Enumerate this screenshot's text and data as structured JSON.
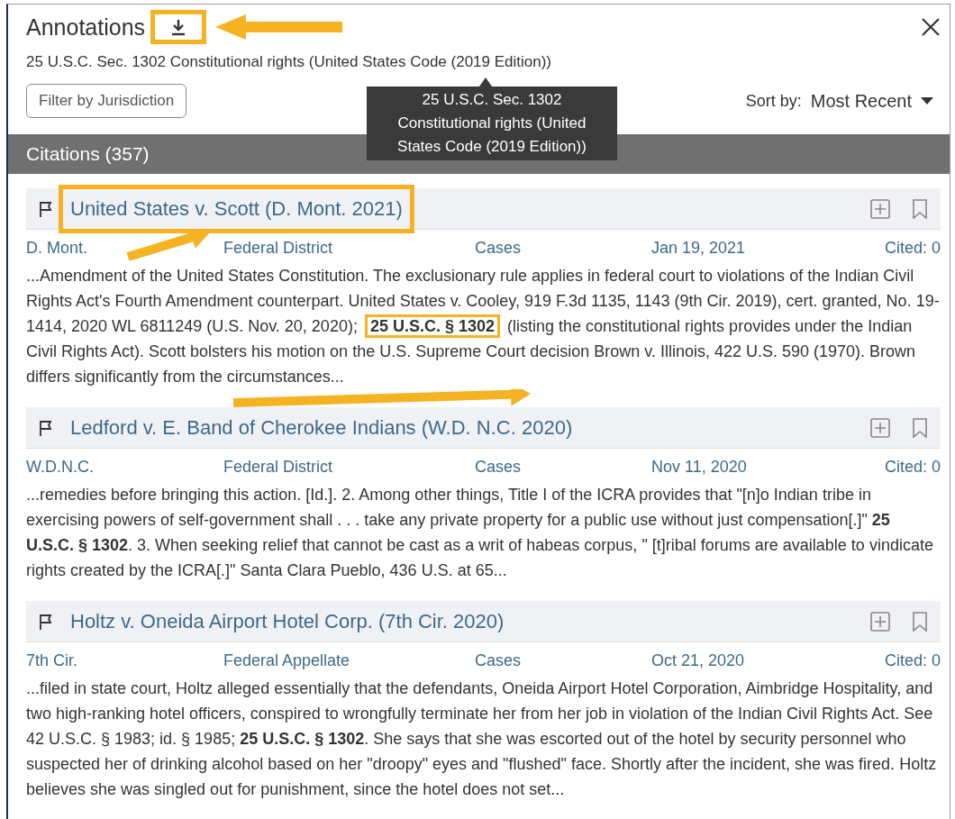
{
  "panel": {
    "title": "Annotations",
    "subtitle": "25 U.S.C. Sec. 1302 Constitutional rights (United States Code (2019 Edition))",
    "filter_button": "Filter by Jurisdiction",
    "sort": {
      "label": "Sort by:",
      "value": "Most Recent"
    },
    "tooltip": "25 U.S.C. Sec. 1302 Constitutional rights (United States Code (2019 Edition))",
    "download_highlighted": true
  },
  "citations": {
    "heading": "Citations (357)",
    "items": [
      {
        "title": "United States v. Scott (D. Mont. 2021)",
        "court": "D. Mont.",
        "level": "Federal District",
        "category": "Cases",
        "date": "Jan 19, 2021",
        "cited": "Cited: 0",
        "highlighted": true,
        "excerpt": "...Amendment of the United States Constitution. The exclusionary rule applies in federal court to violations of the Indian Civil Rights Act's Fourth Amendment counterpart. United States v. Cooley, 919 F.3d 1135, 1143 (9th Cir. 2019), cert. granted, No. 19-1414, 2020 WL 6811249 (U.S. Nov. 20, 2020); **25 U.S.C. § 1302** (listing the constitutional rights provides under the Indian Civil Rights Act).        Scott bolsters his motion on the U.S. Supreme Court decision Brown v. Illinois, 422 U.S. 590 (1970). Brown differs significantly from the circumstances..."
      },
      {
        "title": "Ledford v. E. Band of Cherokee Indians (W.D. N.C. 2020)",
        "court": "W.D.N.C.",
        "level": "Federal District",
        "category": "Cases",
        "date": "Nov 11, 2020",
        "cited": "Cited: 0",
        "highlighted": false,
        "excerpt": "...remedies before bringing this action. [Id.].        2. Among other things, Title I of the ICRA provides that \"[n]o Indian tribe in exercising powers of self-government shall . . . take any private property for a public use without just compensation[.]\" **25 U.S.C. § 1302**.        3. When seeking relief that cannot be cast as a writ of habeas corpus, \" [t]ribal forums are available to vindicate rights created by the ICRA[.]\" Santa Clara Pueblo, 436 U.S. at 65..."
      },
      {
        "title": "Holtz v. Oneida Airport Hotel Corp. (7th Cir. 2020)",
        "court": "7th Cir.",
        "level": "Federal Appellate",
        "category": "Cases",
        "date": "Oct 21, 2020",
        "cited": "Cited: 0",
        "highlighted": false,
        "excerpt": "...filed in state court, Holtz alleged essentially that the defendants, Oneida Airport Hotel Corporation, Aimbridge Hospitality, and two high-ranking hotel officers, conspired to wrongfully terminate her from her job in violation of the Indian Civil Rights Act. See 42 U.S.C. § 1983; id. § 1985; **25 U.S.C. § 1302**. She says that she was escorted out of the hotel by security personnel who suspected her of drinking alcohol based on her \"droopy\" eyes and \"flushed\" face. Shortly after the incident, she was fired. Holtz believes she was singled out for punishment, since the hotel does not set..."
      }
    ]
  }
}
